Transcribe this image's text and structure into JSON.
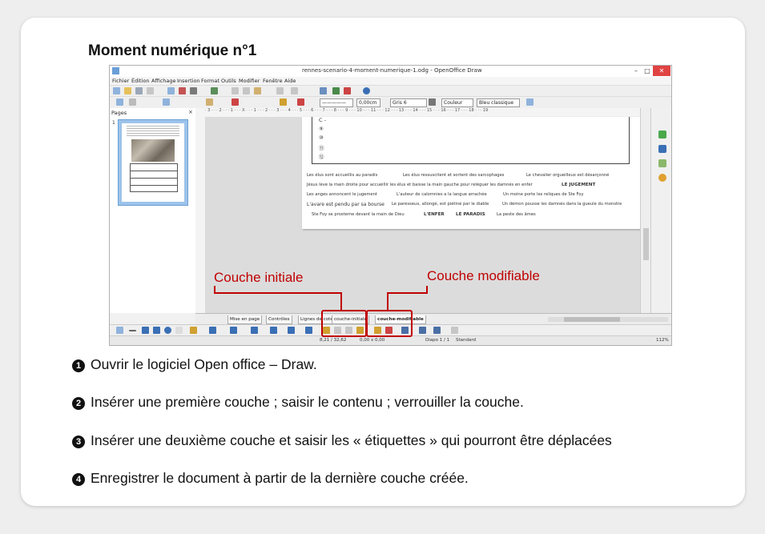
{
  "heading": "Moment numérique n°1",
  "window": {
    "title": "rennes-scenario-4-moment-numerique-1.odg - OpenOffice Draw",
    "minimize": "–",
    "maximize": "□",
    "close": "✕"
  },
  "menu": [
    "Fichier",
    "Édition",
    "Affichage",
    "Insertion",
    "Format",
    "Outils",
    "Modifier",
    "Fenêtre",
    "Aide"
  ],
  "toolbar": {
    "line_width": "0,00cm",
    "area_color": "Gris 6",
    "fill_mode": "Couleur",
    "fill_color": "Bleu classique"
  },
  "pages_panel": {
    "title": "Pages",
    "close": "×",
    "page_number": "1"
  },
  "ruler_ticks": "· 3 · · · 2 · · · 1 · · · X · · · 1 · · · 2 · · · 3 · · · 4 · · · 5 · · · 6 · · · 7 · · · 8 · · · 9 · · · 10 · · · 11 · · · 12 · · · 13 · · · 14 · · · 15 · · · 16 · · · 17 · · · 18 · · · 19",
  "document": {
    "circled": [
      "C -",
      "⑨",
      "⑩",
      "⑪",
      "⑫"
    ],
    "labels": [
      "Les élus sont accueillis au paradis",
      "Les élus ressuscitent et sortent des sarcophages",
      "Le chevalier orgueilleux est désarçonné",
      "Jésus lève la main droite pour accueillir les élus et baisse la main gauche pour reléguer les damnés en enfer",
      "LE JUGEMENT",
      "Les anges annoncent le jugement",
      "L'auteur de calomnies a la langue arrachée",
      "Un moine porte les reliques de Ste Foy",
      "L'avare est pendu par sa bourse",
      "Le paresseux, allongé, est piétiné par le diable",
      "Un démon pousse les damnés dans la gueule du monstre",
      "Ste Foy se prosterne devant la main de Dieu",
      "L'ENFER",
      "LE PARADIS",
      "La peste des âmes"
    ]
  },
  "layer_tabs": [
    "Mise en page",
    "Contrôles",
    "Lignes de cote",
    "couche-initiale",
    "couche-modifiable"
  ],
  "status": {
    "position": "8,21 / 32,62",
    "size": "0,00 x 0,00",
    "slide": "Diapo 1 / 1",
    "style": "Standard",
    "zoom": "112%"
  },
  "callouts": {
    "left": "Couche initiale",
    "right": "Couche modifiable"
  },
  "steps": [
    {
      "num": "1",
      "text": "Ouvrir le logiciel Open office – Draw."
    },
    {
      "num": "2",
      "text": "Insérer une première couche ; saisir le contenu ; verrouiller la couche."
    },
    {
      "num": "3",
      "text": "Insérer une deuxième couche et saisir les « étiquettes » qui pourront être déplacées"
    },
    {
      "num": "4",
      "text": "Enregistrer le document à partir de la dernière couche créée."
    }
  ],
  "colors": {
    "accent_red": "#c00000",
    "close_button": "#e04343",
    "selection_blue": "#9dc3ea"
  }
}
